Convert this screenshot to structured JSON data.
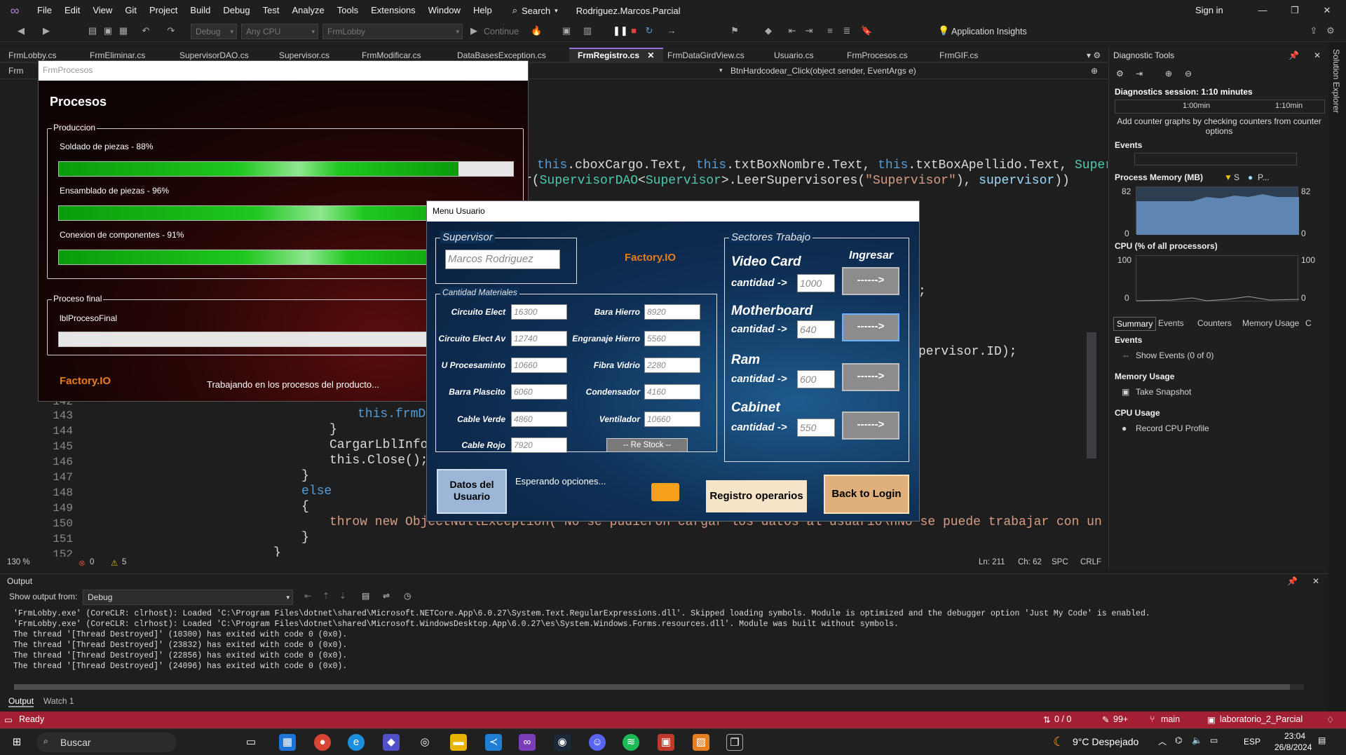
{
  "menubar": {
    "items": [
      "File",
      "Edit",
      "View",
      "Git",
      "Project",
      "Build",
      "Debug",
      "Test",
      "Analyze",
      "Tools",
      "Extensions",
      "Window",
      "Help"
    ],
    "search": "Search",
    "solution": "Rodriguez.Marcos.Parcial",
    "signin": "Sign in"
  },
  "toolbar": {
    "config": "Debug",
    "platform": "Any CPU",
    "project": "FrmLobby",
    "continue": "Continue",
    "insights": "Application Insights"
  },
  "tabs": [
    "FrmLobby.cs",
    "FrmEliminar.cs",
    "SupervisorDAO.cs",
    "Supervisor.cs",
    "FrmModificar.cs",
    "DataBasesException.cs",
    "FrmRegistro.cs",
    "FrmDataGirdView.cs",
    "Usuario.cs",
    "FrmProcesos.cs",
    "FrmGIF.cs"
  ],
  "navbar": {
    "left": "Frm",
    "method": "BtnHardcodear_Click(object sender, EventArgs e)"
  },
  "code": {
    "l1": {
      "a": "this",
      "b": ".cboxCargo.Text, ",
      "c": "this",
      "d": ".txtBoxNombre.Text, ",
      "e": "this",
      "f": ".txtBoxApellido.Text, ",
      "g": "Supervis"
    },
    "l2": {
      "a": "r(",
      "b": "SupervisorDAO",
      "c": "<",
      "d": "Supervisor",
      "e": ">.LeerSupervisores(",
      "f": "\"Supervisor\"",
      "g": "), ",
      "h": "supervisor",
      "i": "))"
    },
    "l3": ";",
    "l4": "pervisor.ID);",
    "lines": [
      {
        "n": "142",
        "t": ""
      },
      {
        "n": "143",
        "t": "this.frmDa"
      },
      {
        "n": "144",
        "t": "}"
      },
      {
        "n": "145",
        "t": "CargarLblInfor"
      },
      {
        "n": "146",
        "t": "this.Close();"
      },
      {
        "n": "147",
        "t": "}"
      },
      {
        "n": "148",
        "t": "else"
      },
      {
        "n": "149",
        "t": "{"
      },
      {
        "n": "150",
        "t": "throw new ObjectNullException(\"No se pudieron cargar los datos al usuario\\nNo se puede trabajar con un dato t"
      },
      {
        "n": "151",
        "t": "}"
      },
      {
        "n": "152",
        "t": "}"
      }
    ]
  },
  "editor_status": {
    "zoom": "130 %",
    "errors": "0",
    "warnings": "5",
    "ln": "Ln: 211",
    "ch": "Ch: 62",
    "spc": "SPC",
    "crlf": "CRLF"
  },
  "diag": {
    "title": "Diagnostic Tools",
    "session": "Diagnostics session: 1:10 minutes",
    "t1": "1:00min",
    "t2": "1:10min",
    "hint": "Add counter graphs by checking counters from counter options",
    "events": "Events",
    "mem_title": "Process Memory (MB)",
    "mem_legend_s": "S",
    "mem_legend_p": "P...",
    "mem_max": "82",
    "mem_min": "0",
    "cpu_title": "CPU (% of all processors)",
    "cpu_max": "100",
    "cpu_min": "0",
    "tabs": [
      "Summary",
      "Events",
      "Counters",
      "Memory Usage",
      "C"
    ],
    "s_events": "Events",
    "show_events": "Show Events (0 of 0)",
    "s_mem": "Memory Usage",
    "snapshot": "Take Snapshot",
    "s_cpu": "CPU Usage",
    "cpu_profile": "Record CPU Profile"
  },
  "rail": "Solution Explorer",
  "output": {
    "title": "Output",
    "show_from": "Show output from:",
    "source": "Debug",
    "lines": [
      "'FrmLobby.exe' (CoreCLR: clrhost): Loaded 'C:\\Program Files\\dotnet\\shared\\Microsoft.NETCore.App\\6.0.27\\System.Text.RegularExpressions.dll'. Skipped loading symbols. Module is optimized and the debugger option 'Just My Code' is enabled.",
      "'FrmLobby.exe' (CoreCLR: clrhost): Loaded 'C:\\Program Files\\dotnet\\shared\\Microsoft.WindowsDesktop.App\\6.0.27\\es\\System.Windows.Forms.resources.dll'. Module was built without symbols.",
      "The thread '[Thread Destroyed]' (10300) has exited with code 0 (0x0).",
      "The thread '[Thread Destroyed]' (23832) has exited with code 0 (0x0).",
      "The thread '[Thread Destroyed]' (22856) has exited with code 0 (0x0).",
      "The thread '[Thread Destroyed]' (24096) has exited with code 0 (0x0)."
    ],
    "tab1": "Output",
    "tab2": "Watch 1"
  },
  "status": {
    "ready": "Ready",
    "updown": "0 / 0",
    "pencil": "99+",
    "branch": "main",
    "repo": "laboratorio_2_Parcial"
  },
  "taskbar": {
    "search": "Buscar",
    "weather": "9°C  Despejado",
    "lang": "ESP",
    "time": "23:04",
    "date": "26/8/2024"
  },
  "procesos": {
    "title": "FrmProcesos",
    "heading": "Procesos",
    "grp1": "Produccion",
    "p1": "Soldado de piezas - 88%",
    "p1_value": 0.88,
    "p2": "Ensamblado de piezas - 96%",
    "p2_value": 0.96,
    "p3": "Conexion de componentes - 91%",
    "p3_value": 0.91,
    "grp2": "Proceso final",
    "final_label": "lblProcesoFinal",
    "final_value": 0,
    "brand": "Factory.IO",
    "working": "Trabajando en los procesos del producto..."
  },
  "menu": {
    "title": "Menu Usuario",
    "grp_sup": "Supervisor",
    "supervisor": "Marcos Rodriguez",
    "brand": "Factory.IO",
    "grp_mat": "Cantidad Materiales",
    "materials": [
      {
        "l": "Circuito Elect",
        "v": "16300"
      },
      {
        "l": "Bara Hierro",
        "v": "8920"
      },
      {
        "l": "Circuito Elect Av",
        "v": "12740"
      },
      {
        "l": "Engranaje Hierro",
        "v": "5560"
      },
      {
        "l": "U Procesaminto",
        "v": "10660"
      },
      {
        "l": "Fibra Vidrio",
        "v": "2280"
      },
      {
        "l": "Barra Plascito",
        "v": "6060"
      },
      {
        "l": "Condensador",
        "v": "4160"
      },
      {
        "l": "Cable Verde",
        "v": "4860"
      },
      {
        "l": "Ventilador",
        "v": "10660"
      },
      {
        "l": "Cable Rojo",
        "v": "7920"
      }
    ],
    "restock": "-- Re Stock --",
    "grp_sect": "Sectores Trabajo",
    "ingresar": "Ingresar",
    "sectors": [
      {
        "name": "Video Card",
        "cant": "cantidad ->",
        "v": "1000",
        "btn": "------>"
      },
      {
        "name": "Motherboard",
        "cant": "cantidad ->",
        "v": "640",
        "btn": "------>"
      },
      {
        "name": "Ram",
        "cant": "cantidad ->",
        "v": "600",
        "btn": "------>"
      },
      {
        "name": "Cabinet",
        "cant": "cantidad ->",
        "v": "550",
        "btn": "------>"
      }
    ],
    "datos_btn": "Datos del Usuario",
    "waiting": "Esperando opciones...",
    "registro_btn": "Registro operarios",
    "back_btn": "Back to Login"
  }
}
